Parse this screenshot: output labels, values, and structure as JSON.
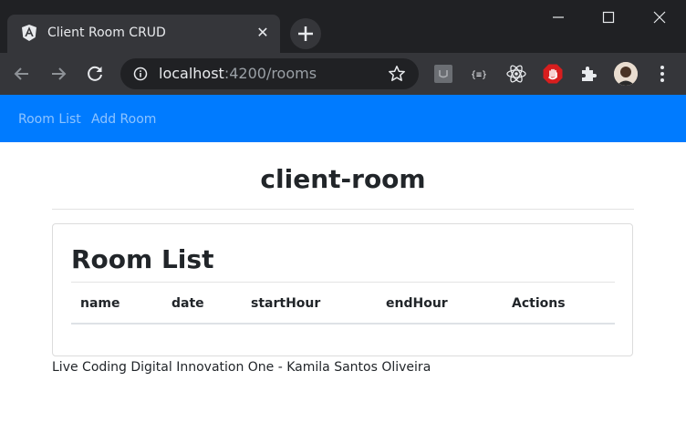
{
  "browser": {
    "tab_title": "Client Room CRUD",
    "tab_close_glyph": "✕",
    "url_host": "localhost",
    "url_rest": ":4200/rooms",
    "icons": {
      "favicon": "angular-icon",
      "new_tab": "plus-icon",
      "back": "arrow-left-icon",
      "forward": "arrow-right-icon",
      "reload": "reload-icon",
      "site_info": "info-icon",
      "bookmark": "star-icon",
      "menu": "kebab-menu-icon"
    },
    "extensions": [
      "extension-box-icon",
      "json-viewer-icon",
      "react-devtools-icon",
      "adblock-icon",
      "puzzle-icon"
    ]
  },
  "navbar": {
    "color": "#007bff",
    "links": [
      "Room List",
      "Add Room"
    ]
  },
  "page": {
    "title": "client-room"
  },
  "card": {
    "title": "Room List",
    "columns": [
      "name",
      "date",
      "startHour",
      "endHour",
      "Actions"
    ]
  },
  "footer": {
    "text": "Live Coding Digital Innovation One - Kamila Santos Oliveira"
  }
}
